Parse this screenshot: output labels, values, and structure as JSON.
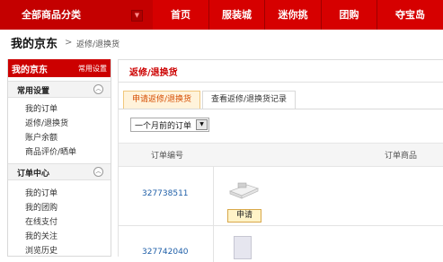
{
  "nav": {
    "all_categories": "全部商品分类",
    "items": [
      "首页",
      "服装城",
      "迷你挑",
      "团购",
      "夺宝岛"
    ]
  },
  "header": {
    "title": "我的京东",
    "breadcrumb": "返修/退换货"
  },
  "sidebar": {
    "title": "我的京东",
    "settings": "常用设置",
    "groups": [
      {
        "title": "常用设置",
        "links": [
          "我的订单",
          "返修/退换货",
          "账户余额",
          "商品评价/晒单"
        ]
      },
      {
        "title": "订单中心",
        "links": [
          "我的订单",
          "我的团购",
          "在线支付",
          "我的关注",
          "浏览历史"
        ]
      }
    ]
  },
  "main": {
    "title": "返修/退换货",
    "tabs": [
      "申请返修/退换货",
      "查看返修/退换货记录"
    ],
    "filter": "一个月前的订单",
    "columns": [
      "订单编号",
      "订单商品"
    ],
    "rows": [
      {
        "order_id": "327738511",
        "action": "申请"
      },
      {
        "order_id": "327742040",
        "action": ""
      }
    ]
  },
  "colors": {
    "brand_red": "#d60000",
    "link_blue": "#1f5fa8",
    "tab_orange": "#d54c00"
  }
}
